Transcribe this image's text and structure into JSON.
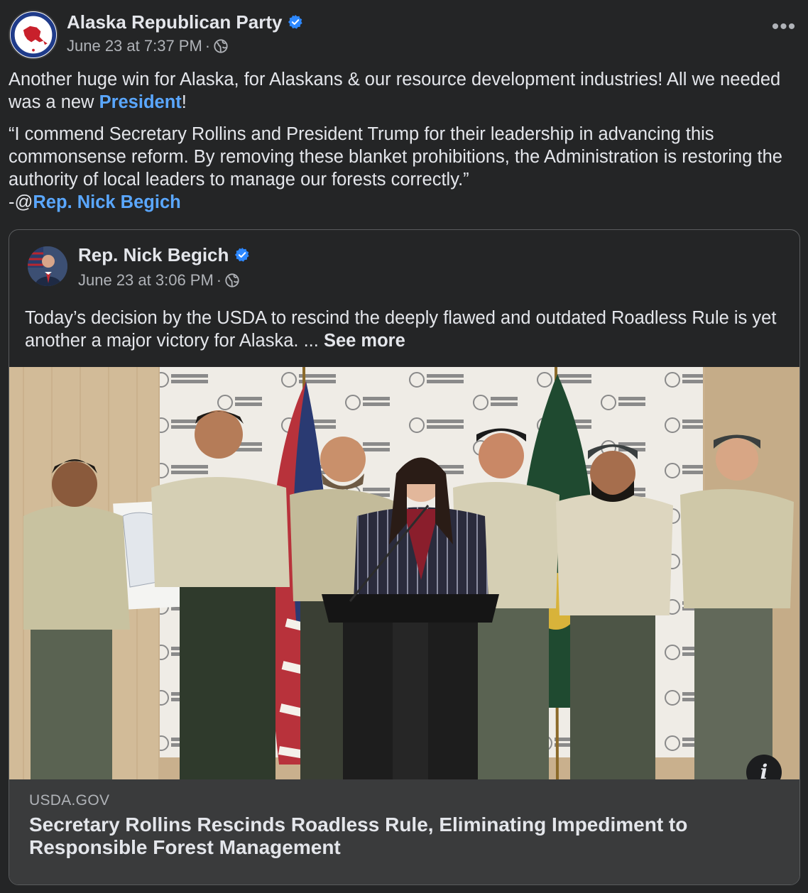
{
  "post": {
    "author": "Alaska Republican Party",
    "timestamp": "June 23 at 7:37 PM",
    "separator": "·",
    "more_label": "•••",
    "paragraph1_before": "Another huge win for Alaska, for Alaskans & our resource development industries! All we needed was a new ",
    "paragraph1_link": "President",
    "paragraph1_after": "!",
    "quote": "“I commend Secretary Rollins and President Trump for their leadership in advancing this commonsense reform. By removing these blanket prohibitions, the Administration is restoring the authority of local leaders to manage our forests correctly.”",
    "attribution_prefix": "-@",
    "attribution_link": "Rep. Nick Begich"
  },
  "shared": {
    "author": "Rep. Nick Begich",
    "timestamp": "June 23 at 3:06 PM",
    "separator": "·",
    "text": "Today’s decision by the USDA to rescind the deeply flawed and outdated Roadless Rule is yet another a major victory for Alaska. ... ",
    "see_more": "See more",
    "info_label": "i",
    "link_domain": "USDA.GOV",
    "link_title": "Secretary Rollins Rescinds Roadless Rule, Eliminating Impediment to Responsible Forest Management"
  },
  "icons": {
    "verified": "verified-badge-icon",
    "audience": "globe-icon",
    "more": "more-options-icon",
    "info": "info-icon"
  },
  "colors": {
    "background": "#242526",
    "link": "#5aa7ff",
    "verified": "#2d88ff",
    "secondary_text": "#b0b3b8"
  }
}
